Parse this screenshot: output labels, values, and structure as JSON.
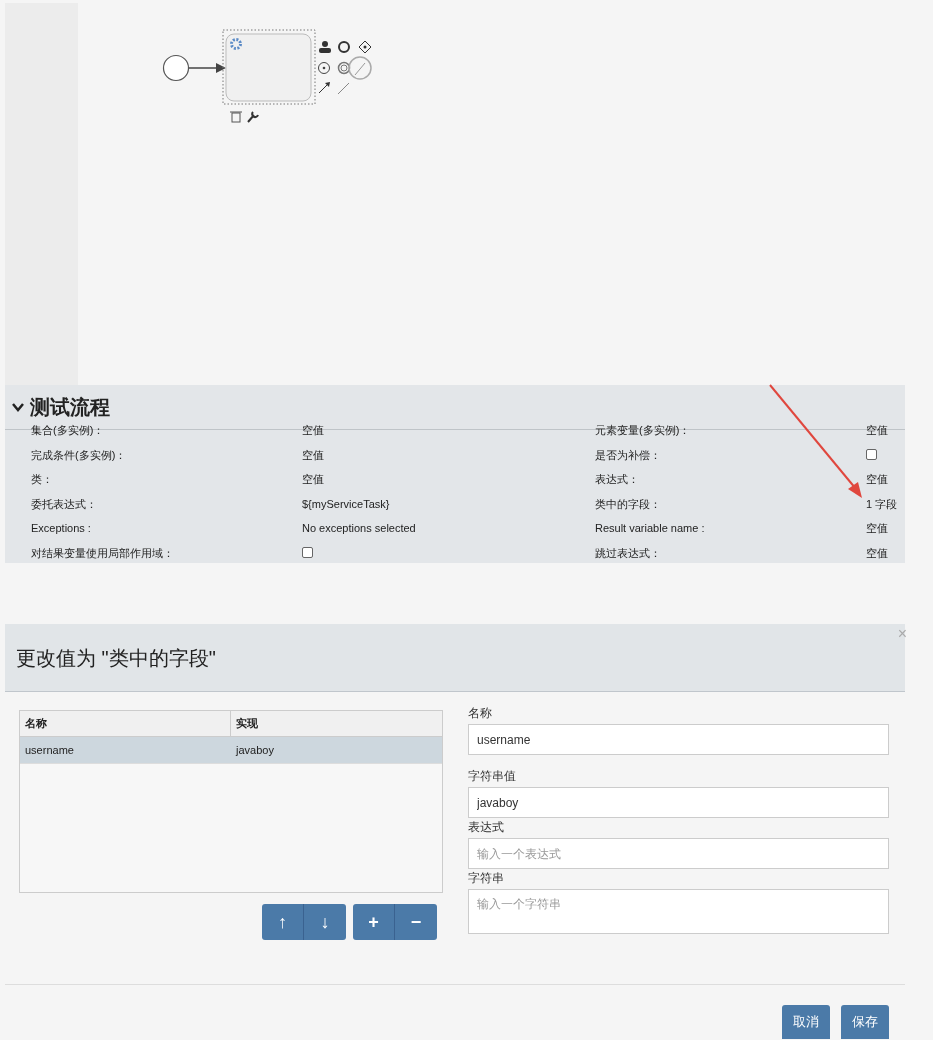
{
  "properties_panel": {
    "title": "测试流程",
    "expanded": true,
    "rows": [
      {
        "cells": [
          {
            "label": "集合(多实例)：",
            "value": "空值",
            "kind": "text"
          },
          {
            "label": "元素变量(多实例)：",
            "value": "空值",
            "kind": "text"
          }
        ]
      },
      {
        "cells": [
          {
            "label": "完成条件(多实例)：",
            "value": "空值",
            "kind": "text"
          },
          {
            "label": "是否为补偿：",
            "checked": false,
            "kind": "checkbox"
          }
        ]
      },
      {
        "cells": [
          {
            "label": "类：",
            "value": "空值",
            "kind": "text"
          },
          {
            "label": "表达式：",
            "value": "空值",
            "kind": "text"
          }
        ]
      },
      {
        "cells": [
          {
            "label": "委托表达式：",
            "value": "${myServiceTask}",
            "kind": "text"
          },
          {
            "label": "类中的字段：",
            "value": "1 字段",
            "kind": "text"
          }
        ]
      },
      {
        "cells": [
          {
            "label": "Exceptions :",
            "value": "No exceptions selected",
            "kind": "text"
          },
          {
            "label": "Result variable name :",
            "value": "空值",
            "kind": "text"
          }
        ]
      },
      {
        "cells": [
          {
            "label": "对结果变量使用局部作用域：",
            "checked": false,
            "kind": "checkbox"
          },
          {
            "label": "跳过表达式：",
            "value": "空值",
            "kind": "text"
          }
        ]
      }
    ]
  },
  "dialog": {
    "title": "更改值为 \"类中的字段\"",
    "close": "×",
    "table": {
      "columns": [
        "名称",
        "实现"
      ],
      "rows": [
        {
          "cells": [
            "username",
            "javaboy"
          ],
          "selected": true
        }
      ]
    },
    "move_buttons": [
      "↑",
      "↓"
    ],
    "edit_buttons": [
      "+",
      "−"
    ],
    "form": [
      {
        "label": "名称",
        "value": "username",
        "kind": "input"
      },
      {
        "label": "字符串值",
        "value": "javaboy",
        "kind": "input"
      },
      {
        "label": "表达式",
        "placeholder": "输入一个表达式",
        "kind": "input"
      },
      {
        "label": "字符串",
        "placeholder": "输入一个字符串",
        "kind": "textarea"
      }
    ],
    "footer_buttons": [
      "取消",
      "保存"
    ]
  }
}
